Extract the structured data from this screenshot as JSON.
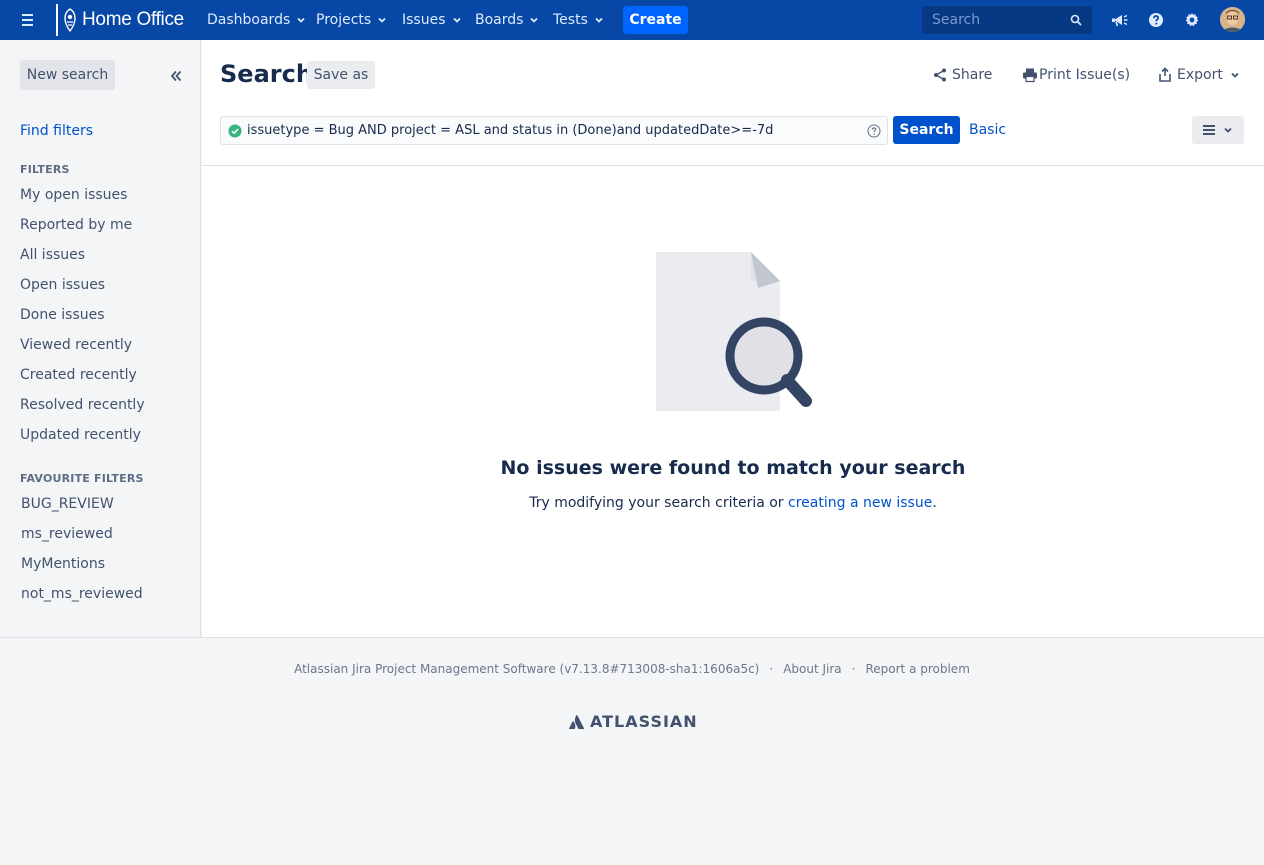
{
  "topnav": {
    "brand": "Home Office",
    "items": [
      {
        "label": "Dashboards"
      },
      {
        "label": "Projects"
      },
      {
        "label": "Issues"
      },
      {
        "label": "Boards"
      },
      {
        "label": "Tests"
      }
    ],
    "create_label": "Create",
    "search_placeholder": "Search",
    "icons": [
      "menu-icon",
      "notifications-icon",
      "help-icon",
      "settings-icon",
      "avatar"
    ]
  },
  "sidebar": {
    "new_search_label": "New search",
    "find_filters_label": "Find filters",
    "filters_title": "FILTERS",
    "filters": [
      {
        "label": "My open issues"
      },
      {
        "label": "Reported by me"
      },
      {
        "label": "All issues"
      },
      {
        "label": "Open issues"
      },
      {
        "label": "Done issues"
      },
      {
        "label": "Viewed recently"
      },
      {
        "label": "Created recently"
      },
      {
        "label": "Resolved recently"
      },
      {
        "label": "Updated recently"
      }
    ],
    "favourites_title": "FAVOURITE FILTERS",
    "favourites": [
      {
        "label": "BUG_REVIEW"
      },
      {
        "label": "ms_reviewed"
      },
      {
        "label": "MyMentions"
      },
      {
        "label": "not_ms_reviewed"
      }
    ]
  },
  "main": {
    "title": "Search",
    "save_as_label": "Save as",
    "share_label": "Share",
    "print_label": "Print Issue(s)",
    "export_label": "Export",
    "jql_query": "issuetype = Bug AND project = ASL and status in (Done)and updatedDate>=-7d",
    "search_button_label": "Search",
    "basic_link_label": "Basic",
    "empty_title": "No issues were found to match your search",
    "empty_text_prefix": "Try modifying your search criteria or ",
    "empty_link": "creating a new issue",
    "empty_text_suffix": "."
  },
  "footer": {
    "software": "Atlassian Jira Project Management Software (v7.13.8#713008-sha1:1606a5c)",
    "separator": "·",
    "about": "About Jira",
    "report": "Report a problem",
    "logo_text": "ATLASSIAN"
  },
  "colors": {
    "nav_bg": "#0747a6",
    "create_button": "#0065ff",
    "primary": "#0052cc",
    "success": "#36b37e"
  }
}
